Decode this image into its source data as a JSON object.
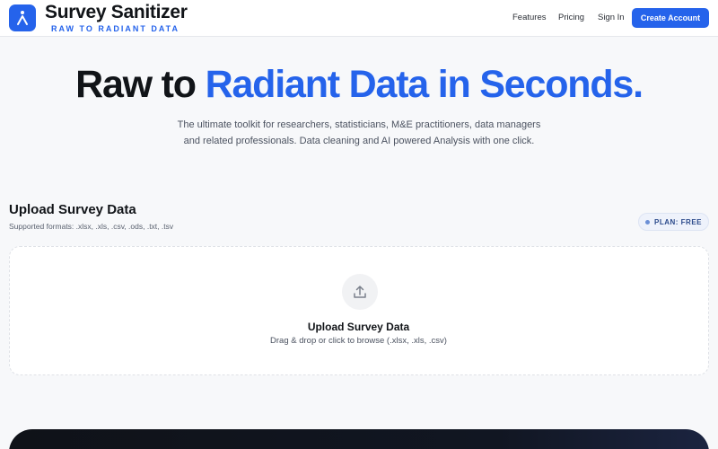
{
  "header": {
    "brand_name": "Survey Sanitizer",
    "brand_tagline": "RAW TO RADIANT DATA",
    "nav": {
      "features": "Features",
      "pricing": "Pricing",
      "signin": "Sign In"
    },
    "cta": "Create Account",
    "accent_color": "#2563eb",
    "logo_icon": "logo-mark-icon"
  },
  "hero": {
    "title_plain": "Raw to ",
    "title_accent": "Radiant Data in Seconds.",
    "subtitle": "The ultimate toolkit for researchers, statisticians, M&E practitioners, data managers and related professionals. Data cleaning and AI powered Analysis with one click."
  },
  "upload": {
    "heading": "Upload Survey Data",
    "formats": "Supported formats: .xlsx, .xls, .csv, .ods, .txt, .tsv",
    "plan_badge": "PLAN: FREE",
    "dropzone": {
      "icon": "upload-icon",
      "title": "Upload Survey Data",
      "subtitle": "Drag & drop or click to browse (.xlsx, .xls, .csv)"
    }
  }
}
